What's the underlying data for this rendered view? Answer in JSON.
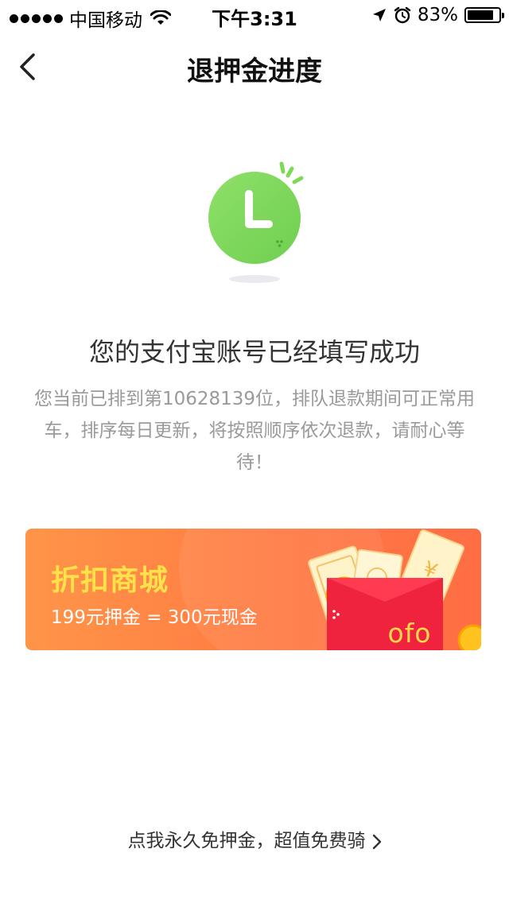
{
  "status_bar": {
    "carrier": "中国移动",
    "time": "下午3:31",
    "battery_percent": "83%",
    "battery_level": 0.83,
    "icons": [
      "signal-dots-icon",
      "wifi-icon",
      "location-arrow-icon",
      "alarm-clock-icon",
      "battery-icon"
    ]
  },
  "nav": {
    "back_icon": "chevron-left-icon",
    "title": "退押金进度"
  },
  "illustration": {
    "icon": "clock-icon",
    "accent_color": "#7ed957"
  },
  "message": {
    "title": "您的支付宝账号已经填写成功",
    "description": "您当前已排到第10628139位，排队退款期间可正常用车，排序每日更新，将按照顺序依次退款，请耐心等待！"
  },
  "promo_banner": {
    "title": "折扣商城",
    "subtitle": "199元押金 = 300元现金",
    "envelope_label": "ofo",
    "icon": "red-envelope-icon",
    "colors": {
      "background_start": "#ff9548",
      "background_end": "#ff6d44",
      "title": "#ffe14a",
      "envelope": "#f0233e"
    }
  },
  "footer": {
    "link_text": "点我永久免押金，超值免费骑",
    "icon": "chevron-right-icon"
  }
}
